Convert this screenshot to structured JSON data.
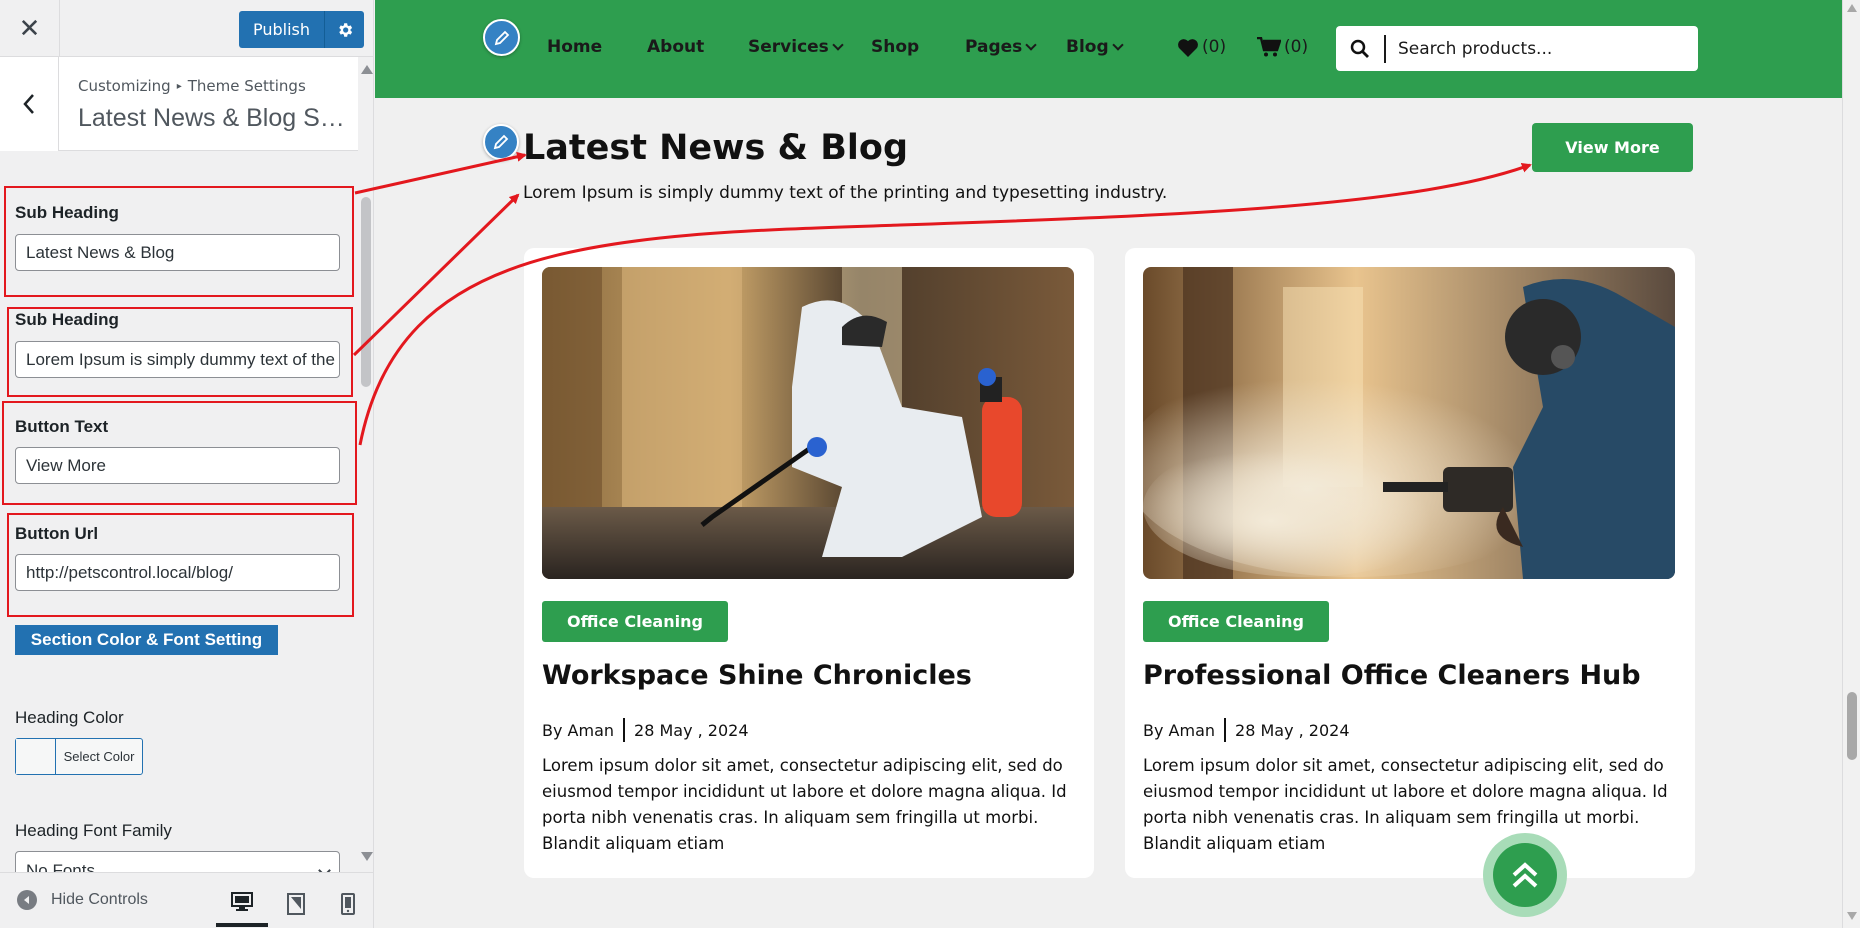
{
  "customizer": {
    "close_icon": "close-icon",
    "publish_label": "Publish",
    "breadcrumb": {
      "root": "Customizing",
      "separator": "▸",
      "parent": "Theme Settings"
    },
    "section_title": "Latest News & Blog Section",
    "fields": [
      {
        "label": "Sub Heading",
        "value": "Latest News & Blog"
      },
      {
        "label": "Sub Heading",
        "value": "Lorem Ipsum is simply dummy text of the printing and typesetting industry."
      },
      {
        "label": "Button Text",
        "value": "View More"
      },
      {
        "label": "Button Url",
        "value": "http://petscontrol.local/blog/"
      }
    ],
    "section_color_button": "Section Color & Font Setting",
    "heading_color_label": "Heading Color",
    "select_color_label": "Select Color",
    "heading_font_label": "Heading Font Family",
    "heading_font_value": "No Fonts",
    "hide_controls_label": "Hide Controls",
    "accent": "#2271b1",
    "highlight": "#e3181e"
  },
  "site": {
    "nav": [
      {
        "label": "Home",
        "dropdown": false
      },
      {
        "label": "About",
        "dropdown": false
      },
      {
        "label": "Services",
        "dropdown": true
      },
      {
        "label": "Shop",
        "dropdown": false
      },
      {
        "label": "Pages",
        "dropdown": true
      },
      {
        "label": "Blog",
        "dropdown": true
      }
    ],
    "wishlist_count": "(0)",
    "cart_count": "(0)",
    "search_placeholder": "Search products...",
    "brand_color": "#2e9e4f"
  },
  "blog_section": {
    "heading": "Latest News & Blog",
    "subheading": "Lorem Ipsum is simply dummy text of the printing and typesetting industry.",
    "button": "View More",
    "posts": [
      {
        "category": "Office Cleaning",
        "title": "Workspace Shine Chronicles",
        "author": "By Aman",
        "date": "28 May , 2024",
        "excerpt": "Lorem ipsum dolor sit amet, consectetur adipiscing elit, sed do eiusmod tempor incididunt ut labore et dolore magna aliqua. Id porta nibh venenatis cras. In aliquam sem fringilla ut morbi. Blandit aliquam etiam"
      },
      {
        "category": "Office Cleaning",
        "title": "Professional Office Cleaners Hub",
        "author": "By Aman",
        "date": "28 May , 2024",
        "excerpt": "Lorem ipsum dolor sit amet, consectetur adipiscing elit, sed do eiusmod tempor incididunt ut labore et dolore magna aliqua. Id porta nibh venenatis cras. In aliquam sem fringilla ut morbi. Blandit aliquam etiam"
      }
    ]
  }
}
